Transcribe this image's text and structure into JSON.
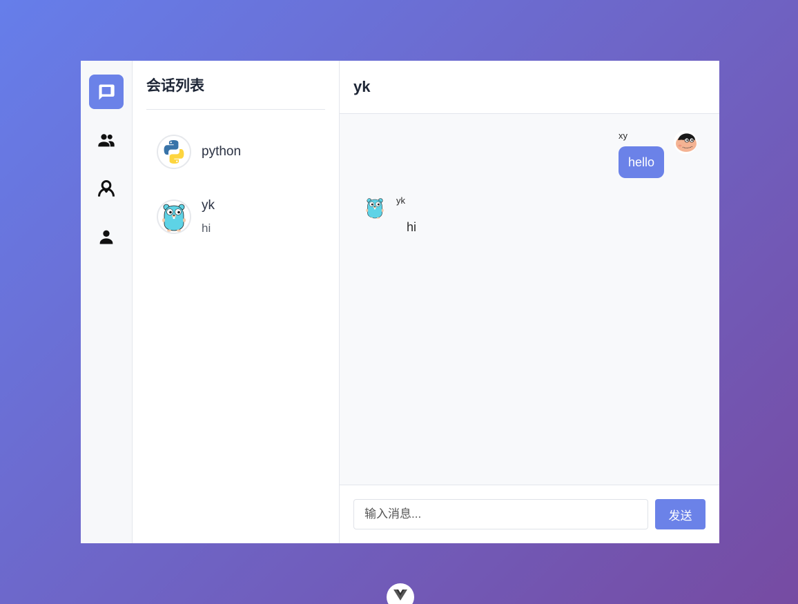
{
  "nav": {
    "items": [
      {
        "icon": "chat-icon",
        "active": true
      },
      {
        "icon": "group-icon",
        "active": false
      },
      {
        "icon": "contacts-icon",
        "active": false
      },
      {
        "icon": "user-icon",
        "active": false
      }
    ]
  },
  "conversations": {
    "title": "会话列表",
    "items": [
      {
        "name": "python",
        "preview": "",
        "avatar": "python-logo-icon"
      },
      {
        "name": "yk",
        "preview": "hi",
        "avatar": "gopher-icon"
      }
    ]
  },
  "chat": {
    "title": "yk",
    "messages": [
      {
        "sender": "xy",
        "text": "hello",
        "self": true,
        "avatar": "cartoon-avatar-icon"
      },
      {
        "sender": "yk",
        "text": "hi",
        "self": false,
        "avatar": "gopher-icon"
      }
    ],
    "input_placeholder": "输入消息...",
    "send_label": "发送"
  },
  "colors": {
    "accent": "#6b82e8",
    "background_start": "#667eea",
    "background_end": "#764ba2"
  }
}
